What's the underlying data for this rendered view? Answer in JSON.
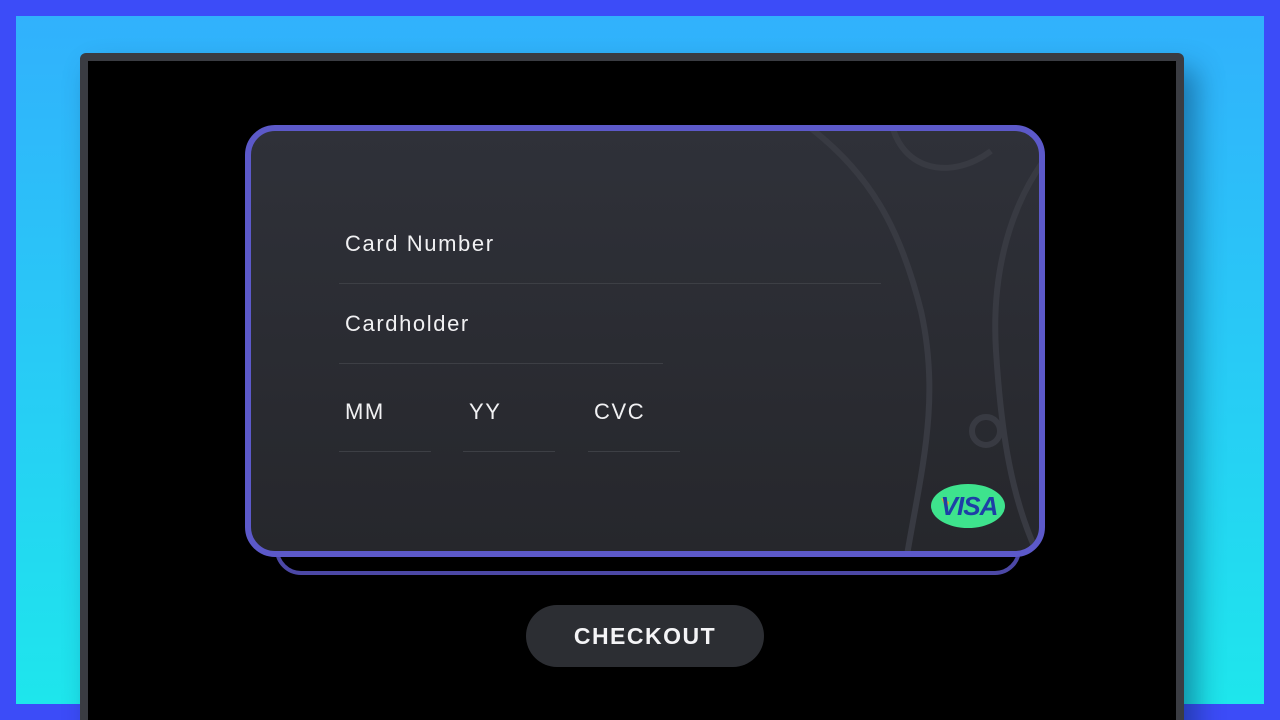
{
  "card": {
    "fields": {
      "card_number": "Card Number",
      "cardholder": "Cardholder",
      "month": "MM",
      "year": "YY",
      "cvc": "CVC"
    },
    "brand": {
      "label": "VISA",
      "badge_color": "#3ee38d",
      "text_color": "#1d3fa6",
      "accent_color": "#f4a91c"
    },
    "border_color": "#5c59c9"
  },
  "checkout_button": {
    "label": "CHECKOUT"
  }
}
